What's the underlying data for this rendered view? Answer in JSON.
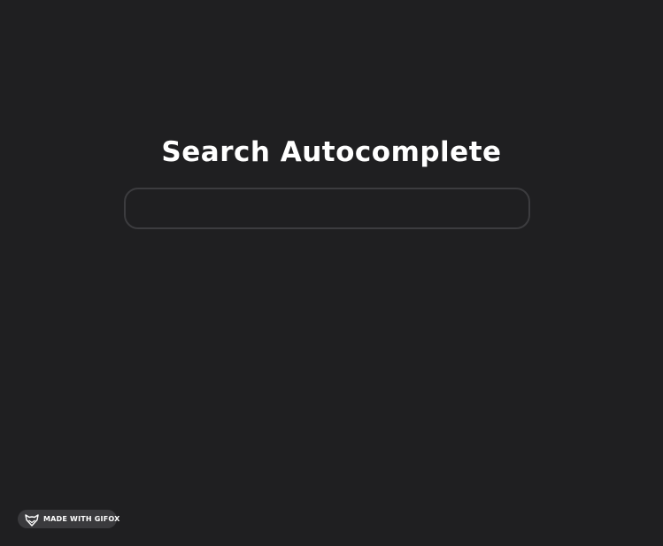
{
  "page": {
    "title": "Search Autocomplete",
    "background_color": "#1f1f21"
  },
  "search": {
    "value": "",
    "placeholder": ""
  },
  "badge": {
    "icon": "fox-icon",
    "label": "MADE WITH GIFOX"
  }
}
